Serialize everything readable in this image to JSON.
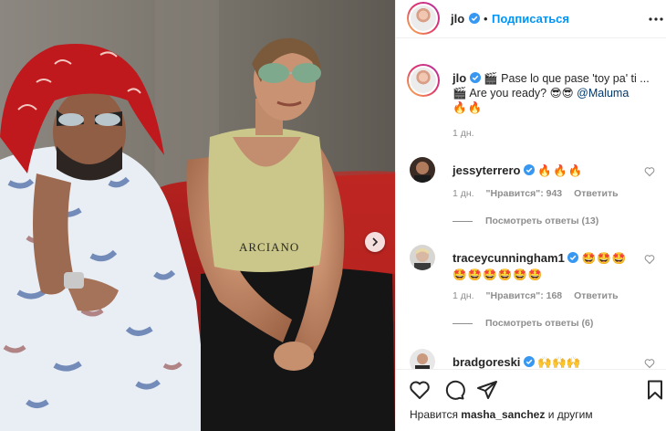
{
  "header": {
    "username": "jlo",
    "separator": "•",
    "follow_label": "Подписаться"
  },
  "caption": {
    "username": "jlo",
    "line1": "🎬 Pase lo que pase 'toy pa' ti ...",
    "line2": "🎬 Are you ready? 😎😎",
    "mention": "@Maluma",
    "line3": "🔥🔥",
    "time": "1 дн."
  },
  "comments": [
    {
      "username": "jessyterrero",
      "text": "🔥🔥🔥",
      "time": "1 дн.",
      "likes": "\"Нравится\": 943",
      "reply_label": "Ответить",
      "view_replies": "Посмотреть ответы (13)"
    },
    {
      "username": "traceycunningham1",
      "text": "🤩🤩🤩 🤩🤩🤩🤩🤩🤩",
      "time": "1 дн.",
      "likes": "\"Нравится\": 168",
      "reply_label": "Ответить",
      "view_replies": "Посмотреть ответы (6)"
    },
    {
      "username": "bradgoreski",
      "text": "🙌🙌🙌"
    }
  ],
  "footer": {
    "liked_prefix": "Нравится",
    "liked_user": "masha_sanchez",
    "liked_suffix": "и другим"
  },
  "colors": {
    "accent": "#0095f6",
    "verified": "#3897f0",
    "muted": "#8e8e8e"
  },
  "icons": [
    "more-options-icon",
    "heart-icon",
    "comment-icon",
    "share-icon",
    "bookmark-icon",
    "verified-badge-icon",
    "next-photo-icon"
  ]
}
